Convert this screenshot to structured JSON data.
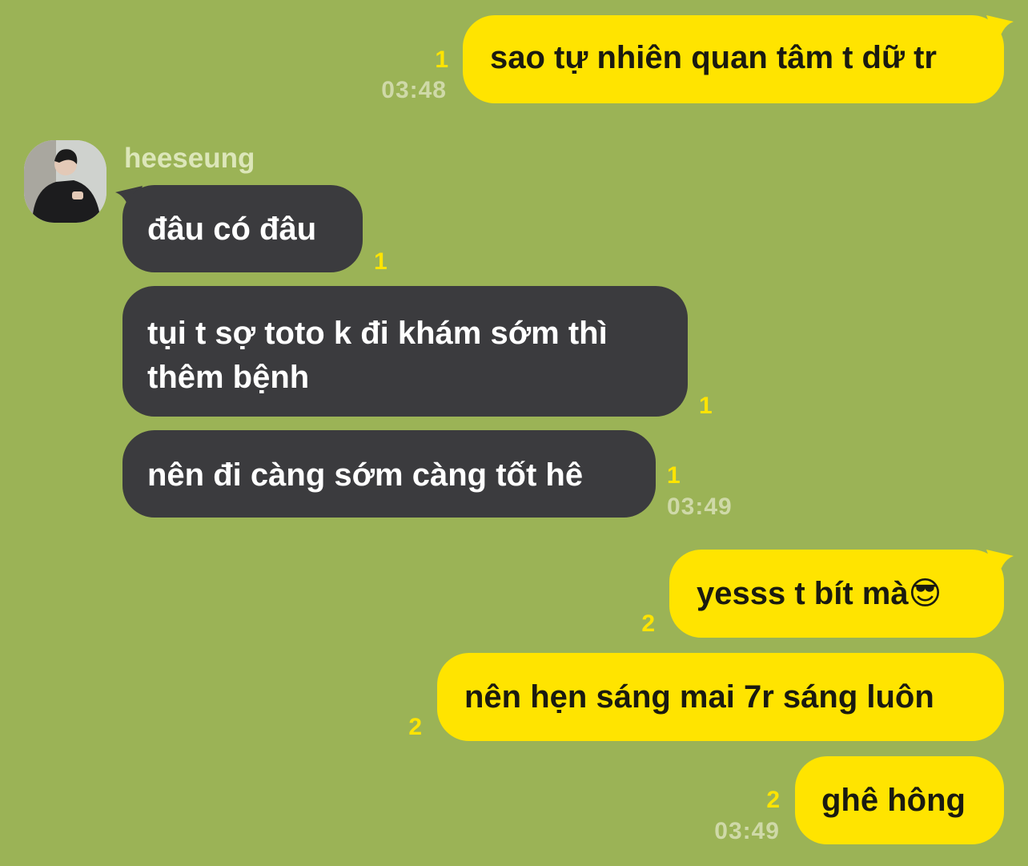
{
  "contact": {
    "name": "heeseung",
    "avatar_icon": "profile-photo"
  },
  "messages": [
    {
      "from": "me",
      "text": "sao tự nhiên quan tâm t dữ tr",
      "unread": "1",
      "time": "03:48"
    },
    {
      "from": "them",
      "text": "đâu có đâu",
      "unread": "1"
    },
    {
      "from": "them",
      "lines": [
        "tụi t sợ toto k đi khám sớm thì",
        "thêm bệnh"
      ],
      "unread": "1"
    },
    {
      "from": "them",
      "text": "nên đi càng sớm càng tốt hê",
      "unread": "1",
      "time": "03:49"
    },
    {
      "from": "me",
      "text": "yesss t bít mà",
      "emoji": "😎",
      "emoji_icon": "sunglasses-emoji",
      "unread": "2"
    },
    {
      "from": "me",
      "text": "nên hẹn sáng mai 7r sáng luôn",
      "unread": "2"
    },
    {
      "from": "me",
      "text": "ghê hông",
      "unread": "2",
      "time": "03:49"
    }
  ],
  "colors": {
    "background": "#9bb356",
    "my_bubble": "#ffe400",
    "their_bubble": "#3b3b3e",
    "unread": "#ffe400",
    "time": "#cfd9a8"
  }
}
